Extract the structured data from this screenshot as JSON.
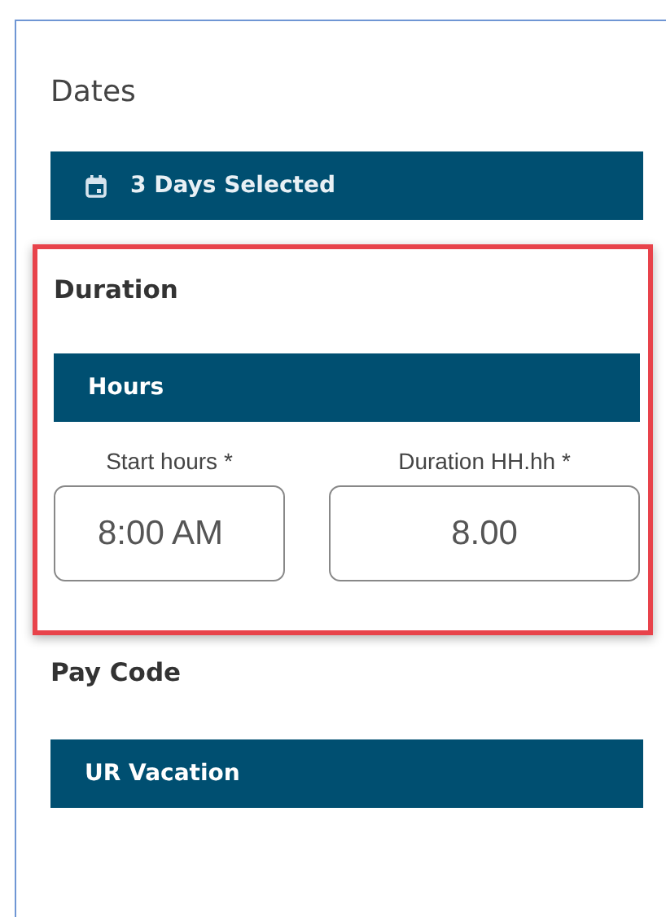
{
  "dates": {
    "title": "Dates",
    "button": "3 Days Selected"
  },
  "duration": {
    "title": "Duration",
    "highlighted": true,
    "bar": "Hours",
    "fields": [
      {
        "label": "Start hours *",
        "value": "8:00 AM",
        "kind": "time"
      },
      {
        "label": "Duration HH.hh *",
        "value": "8.00",
        "kind": "number"
      }
    ]
  },
  "pay_code": {
    "title": "Pay Code",
    "bar": "UR Vacation"
  }
}
